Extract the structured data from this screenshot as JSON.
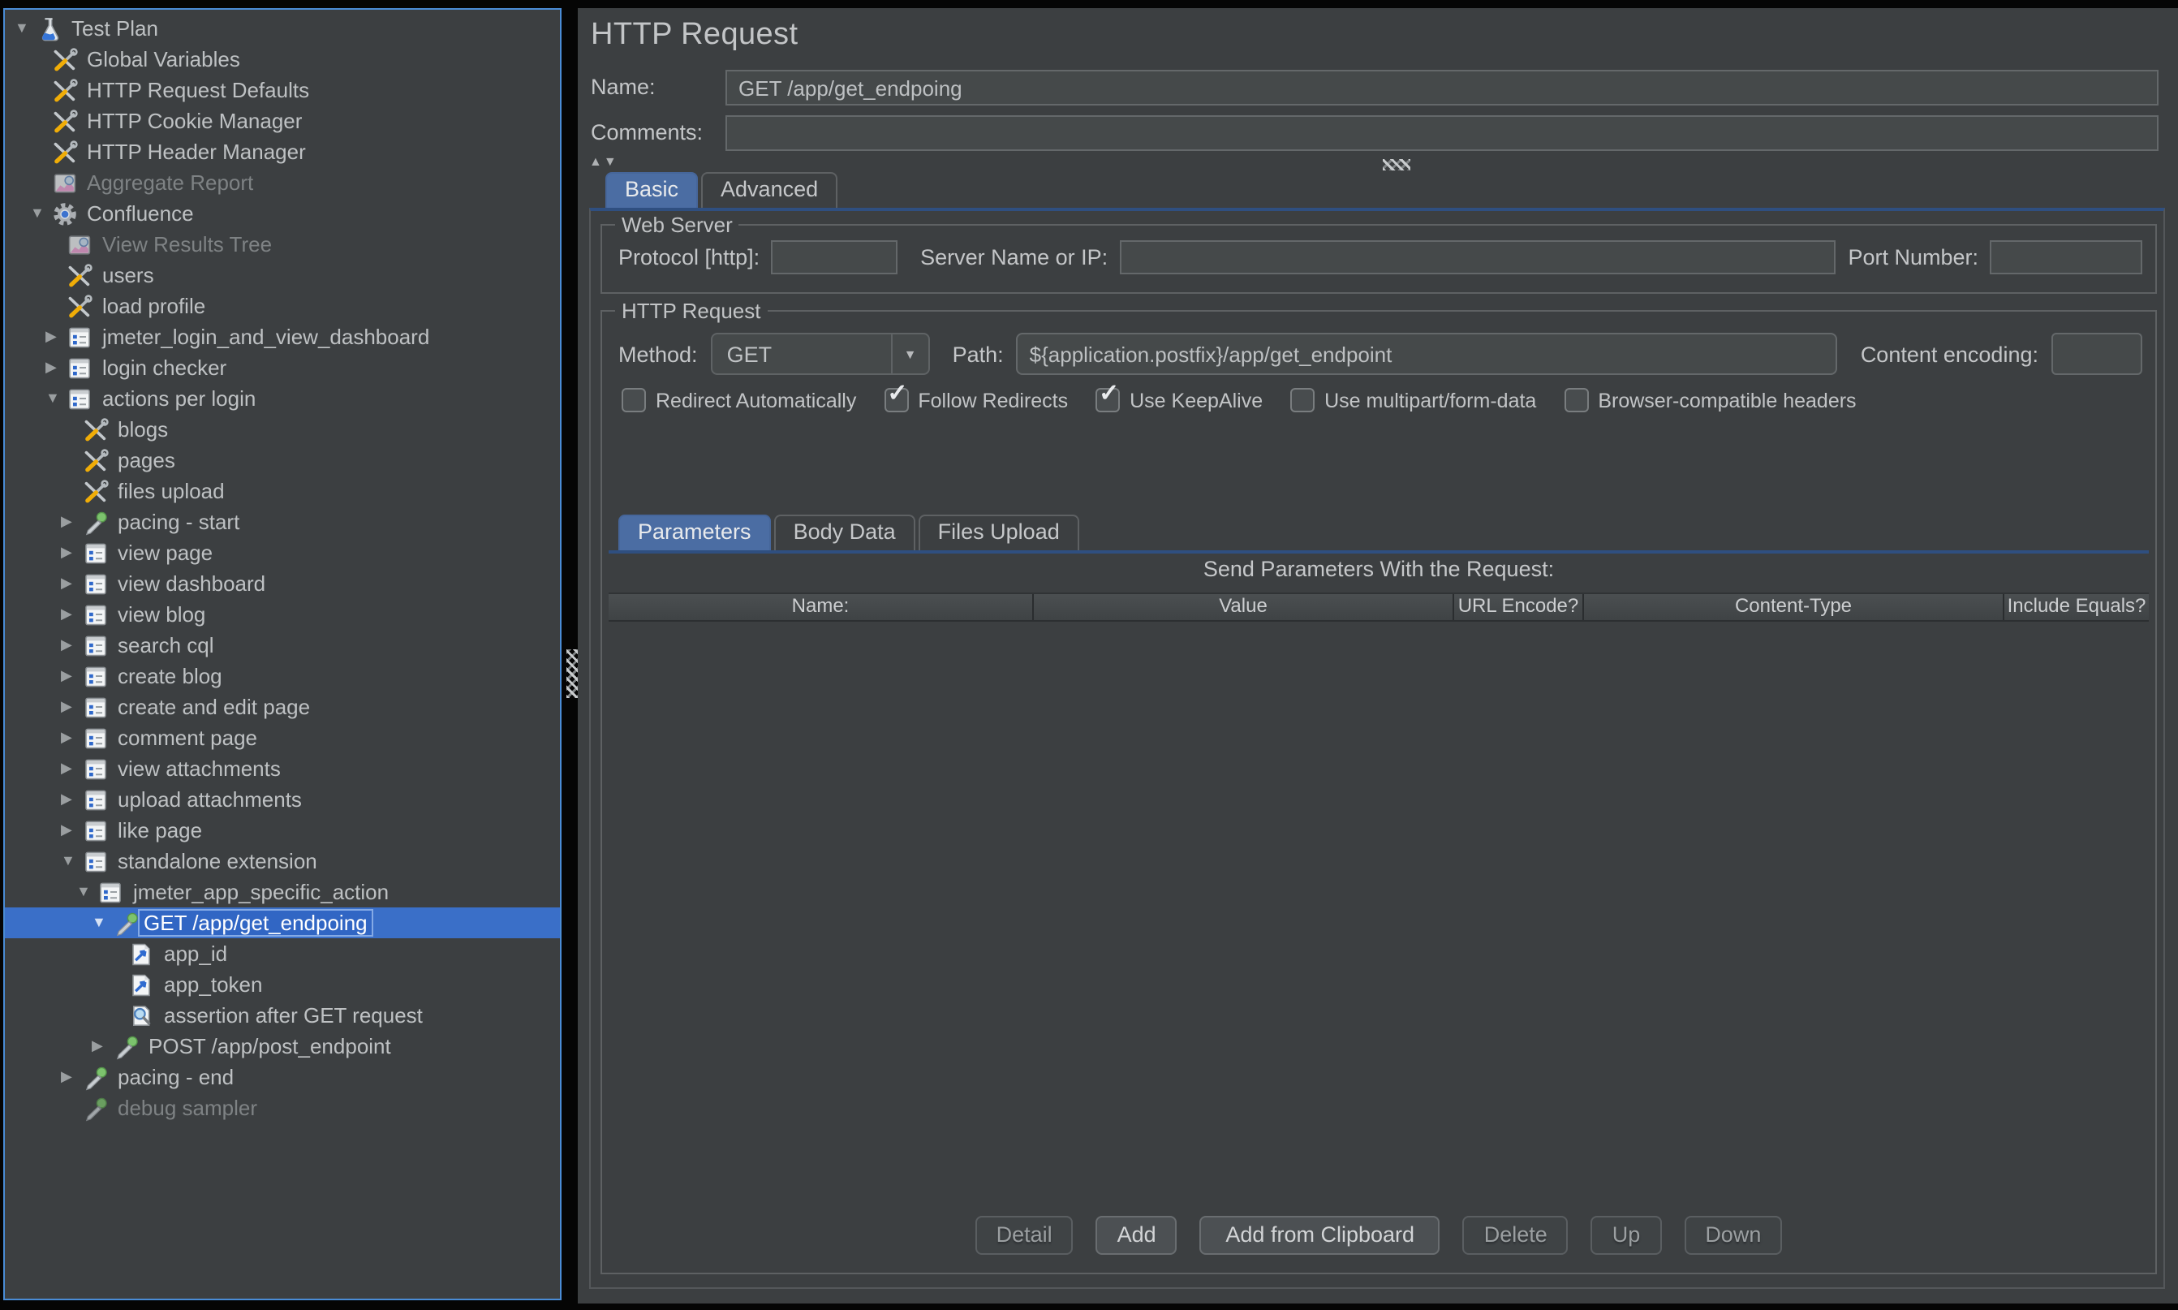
{
  "colors": {
    "panel_bg": "#3c3f41",
    "focus_border_blue": "#4a8cd6",
    "selection_blue": "#3a6fc8",
    "tab_selected_blue": "#4b6da3",
    "tab_underline_blue": "#2f4f80",
    "input_bg": "#45494a",
    "border_gray": "#5e6163"
  },
  "tree": {
    "items": [
      {
        "label": "Test Plan",
        "level": 0,
        "state": "expanded",
        "icon": "beaker-icon"
      },
      {
        "label": "Global Variables",
        "level": 1,
        "state": "leaf",
        "icon": "config-icon"
      },
      {
        "label": "HTTP Request Defaults",
        "level": 1,
        "state": "leaf",
        "icon": "config-icon"
      },
      {
        "label": "HTTP Cookie Manager",
        "level": 1,
        "state": "leaf",
        "icon": "config-icon"
      },
      {
        "label": "HTTP Header Manager",
        "level": 1,
        "state": "leaf",
        "icon": "config-icon"
      },
      {
        "label": "Aggregate Report",
        "level": 1,
        "state": "leaf",
        "icon": "chart-icon",
        "disabled": true
      },
      {
        "label": "Confluence",
        "level": 1,
        "state": "expanded",
        "icon": "gear-icon"
      },
      {
        "label": "View Results Tree",
        "level": 2,
        "state": "leaf",
        "icon": "chart-icon",
        "disabled": true
      },
      {
        "label": "users",
        "level": 2,
        "state": "leaf",
        "icon": "config-icon"
      },
      {
        "label": "load profile",
        "level": 2,
        "state": "leaf",
        "icon": "config-icon"
      },
      {
        "label": "jmeter_login_and_view_dashboard",
        "level": 2,
        "state": "collapsed",
        "icon": "controller-icon"
      },
      {
        "label": "login checker",
        "level": 2,
        "state": "collapsed",
        "icon": "controller-icon"
      },
      {
        "label": "actions per login",
        "level": 2,
        "state": "expanded",
        "icon": "controller-icon"
      },
      {
        "label": "blogs",
        "level": 3,
        "state": "leaf",
        "icon": "config-icon"
      },
      {
        "label": "pages",
        "level": 3,
        "state": "leaf",
        "icon": "config-icon"
      },
      {
        "label": "files upload",
        "level": 3,
        "state": "leaf",
        "icon": "config-icon"
      },
      {
        "label": "pacing - start",
        "level": 3,
        "state": "collapsed",
        "icon": "sampler-icon"
      },
      {
        "label": "view page",
        "level": 3,
        "state": "collapsed",
        "icon": "controller-icon"
      },
      {
        "label": "view dashboard",
        "level": 3,
        "state": "collapsed",
        "icon": "controller-icon"
      },
      {
        "label": "view blog",
        "level": 3,
        "state": "collapsed",
        "icon": "controller-icon"
      },
      {
        "label": "search cql",
        "level": 3,
        "state": "collapsed",
        "icon": "controller-icon"
      },
      {
        "label": "create blog",
        "level": 3,
        "state": "collapsed",
        "icon": "controller-icon"
      },
      {
        "label": "create and edit page",
        "level": 3,
        "state": "collapsed",
        "icon": "controller-icon"
      },
      {
        "label": "comment page",
        "level": 3,
        "state": "collapsed",
        "icon": "controller-icon"
      },
      {
        "label": "view attachments",
        "level": 3,
        "state": "collapsed",
        "icon": "controller-icon"
      },
      {
        "label": "upload attachments",
        "level": 3,
        "state": "collapsed",
        "icon": "controller-icon"
      },
      {
        "label": "like page",
        "level": 3,
        "state": "collapsed",
        "icon": "controller-icon"
      },
      {
        "label": "standalone extension",
        "level": 3,
        "state": "expanded",
        "icon": "controller-icon"
      },
      {
        "label": "jmeter_app_specific_action",
        "level": 4,
        "state": "expanded",
        "icon": "controller-icon"
      },
      {
        "label": "GET /app/get_endpoing",
        "level": 5,
        "state": "expanded",
        "icon": "sampler-icon",
        "selected": true
      },
      {
        "label": "app_id",
        "level": 6,
        "state": "leaf",
        "icon": "extractor-icon"
      },
      {
        "label": "app_token",
        "level": 6,
        "state": "leaf",
        "icon": "extractor-icon"
      },
      {
        "label": "assertion after GET request",
        "level": 6,
        "state": "leaf",
        "icon": "assertion-icon"
      },
      {
        "label": "POST /app/post_endpoint",
        "level": 5,
        "state": "collapsed",
        "icon": "sampler-icon"
      },
      {
        "label": "pacing - end",
        "level": 3,
        "state": "collapsed",
        "icon": "sampler-icon"
      },
      {
        "label": "debug sampler",
        "level": 3,
        "state": "leaf",
        "icon": "sampler-icon",
        "disabled": true
      }
    ]
  },
  "editor": {
    "title": "HTTP Request",
    "name": {
      "label": "Name:",
      "value": "GET /app/get_endpoing"
    },
    "comments": {
      "label": "Comments:",
      "value": ""
    },
    "tabs": {
      "items": [
        "Basic",
        "Advanced"
      ],
      "selected": "Basic"
    },
    "web_server": {
      "legend": "Web Server",
      "protocol_label": "Protocol [http]:",
      "protocol_value": "",
      "server_label": "Server Name or IP:",
      "server_value": "",
      "port_label": "Port Number:",
      "port_value": ""
    },
    "http_request": {
      "legend": "HTTP Request",
      "method_label": "Method:",
      "method_value": "GET",
      "path_label": "Path:",
      "path_value": "${application.postfix}/app/get_endpoint",
      "content_encoding_label": "Content encoding:",
      "content_encoding_value": "",
      "options": [
        {
          "label": "Redirect Automatically",
          "checked": false
        },
        {
          "label": "Follow Redirects",
          "checked": true
        },
        {
          "label": "Use KeepAlive",
          "checked": true
        },
        {
          "label": "Use multipart/form-data",
          "checked": false
        },
        {
          "label": "Browser-compatible headers",
          "checked": false
        }
      ],
      "subtabs": {
        "items": [
          "Parameters",
          "Body Data",
          "Files Upload"
        ],
        "selected": "Parameters"
      },
      "params_table": {
        "caption": "Send Parameters With the Request:",
        "columns": [
          "Name:",
          "Value",
          "URL Encode?",
          "Content-Type",
          "Include Equals?"
        ],
        "rows": []
      },
      "buttons": [
        {
          "label": "Detail",
          "enabled": false
        },
        {
          "label": "Add",
          "enabled": true
        },
        {
          "label": "Add from Clipboard",
          "enabled": true
        },
        {
          "label": "Delete",
          "enabled": false
        },
        {
          "label": "Up",
          "enabled": false
        },
        {
          "label": "Down",
          "enabled": false
        }
      ]
    }
  }
}
